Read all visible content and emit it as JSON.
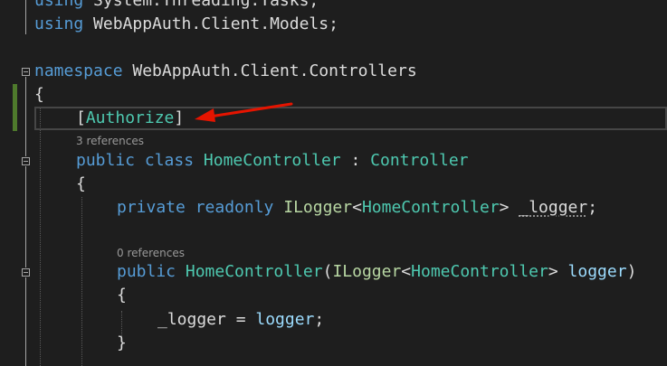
{
  "code": {
    "using1": {
      "kw": "using",
      "text": " System.Threading.Tasks;"
    },
    "using2": {
      "kw": "using",
      "text": " WebAppAuth.Client.Models;"
    },
    "namespace": {
      "kw": "namespace",
      "name": " WebAppAuth.Client.Controllers"
    },
    "open_brace": "{",
    "attribute": {
      "open": "[",
      "name": "Authorize",
      "close": "]"
    },
    "class_refs": "3 references",
    "class_decl": {
      "kw1": "public",
      "kw2": " class",
      "name": " HomeController",
      "sep": " : ",
      "base": "Controller"
    },
    "class_open": "{",
    "field": {
      "kw1": "private",
      "kw2": " readonly",
      "iface": " ILogger",
      "lt": "<",
      "gen": "HomeController",
      "gt": ">",
      "sp": " ",
      "name": "_logger",
      "semi": ";"
    },
    "ctor_refs": "0 references",
    "ctor": {
      "kw": "public",
      "name": " HomeController",
      "paren": "(",
      "iface": "ILogger",
      "lt": "<",
      "gen": "HomeController",
      "gt": ">",
      "sp": " ",
      "param": "logger",
      "close": ")"
    },
    "ctor_open": "{",
    "assign": {
      "left": "_logger",
      "op": " = ",
      "right": "logger",
      "semi": ";"
    },
    "ctor_close": "}"
  },
  "colors": {
    "background": "#1e1e1e",
    "keyword": "#569cd6",
    "type": "#4ec9b0",
    "interface": "#b8d7a3",
    "parameter": "#9cdcfe",
    "annotation_arrow": "#e51400"
  }
}
